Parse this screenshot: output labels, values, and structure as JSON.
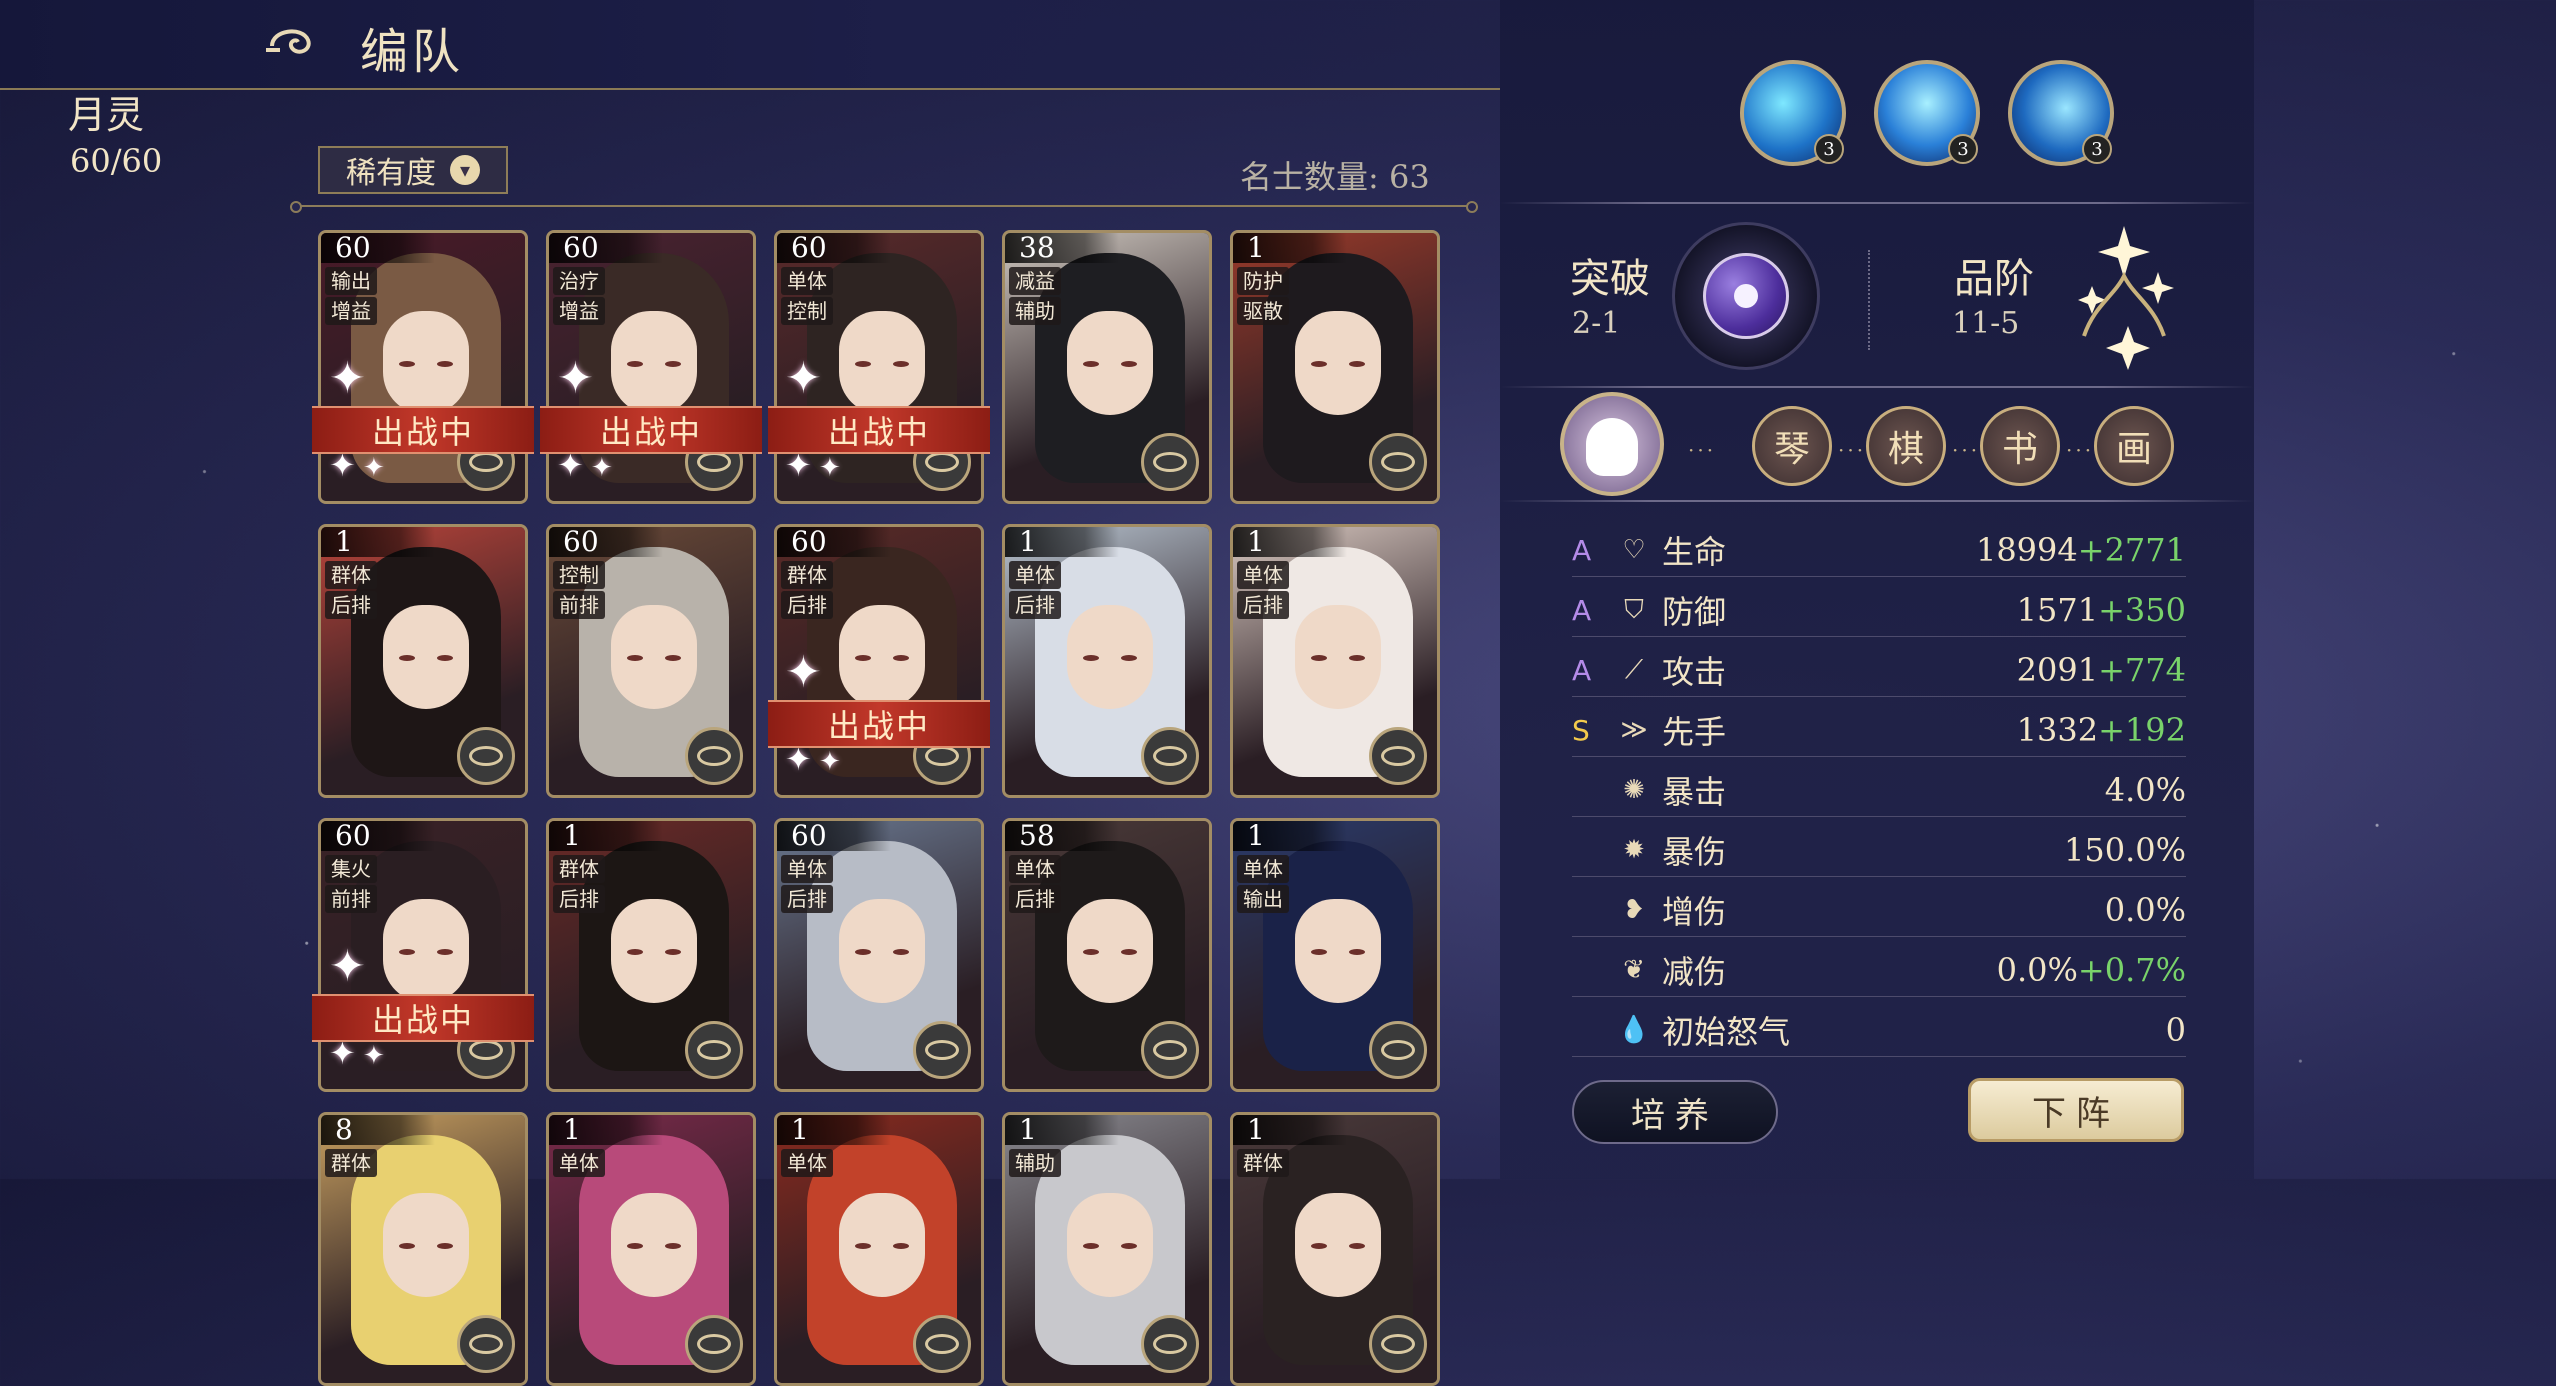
{
  "header": {
    "title": "编队"
  },
  "filter": {
    "label": "稀有度",
    "count_label": "名士数量: 63"
  },
  "status_banner": "出战中",
  "cards": [
    {
      "level": "60",
      "tags": [
        "输出",
        "增益"
      ],
      "deployed": true
    },
    {
      "level": "60",
      "tags": [
        "治疗",
        "增益"
      ],
      "deployed": true
    },
    {
      "level": "60",
      "tags": [
        "单体",
        "控制"
      ],
      "deployed": true
    },
    {
      "level": "38",
      "tags": [
        "减益",
        "辅助"
      ],
      "deployed": false
    },
    {
      "level": "1",
      "tags": [
        "防护",
        "驱散"
      ],
      "deployed": false
    },
    {
      "level": "1",
      "tags": [
        "群体",
        "后排"
      ],
      "deployed": false
    },
    {
      "level": "60",
      "tags": [
        "控制",
        "前排"
      ],
      "deployed": false
    },
    {
      "level": "60",
      "tags": [
        "群体",
        "后排"
      ],
      "deployed": true
    },
    {
      "level": "1",
      "tags": [
        "单体",
        "后排"
      ],
      "deployed": false
    },
    {
      "level": "1",
      "tags": [
        "单体",
        "后排"
      ],
      "deployed": false
    },
    {
      "level": "60",
      "tags": [
        "集火",
        "前排"
      ],
      "deployed": true
    },
    {
      "level": "1",
      "tags": [
        "群体",
        "后排"
      ],
      "deployed": false
    },
    {
      "level": "60",
      "tags": [
        "单体",
        "后排"
      ],
      "deployed": false
    },
    {
      "level": "58",
      "tags": [
        "单体",
        "后排"
      ],
      "deployed": false
    },
    {
      "level": "1",
      "tags": [
        "单体",
        "输出"
      ],
      "deployed": false
    },
    {
      "level": "8",
      "tags": [
        "群体"
      ],
      "deployed": false
    },
    {
      "level": "1",
      "tags": [
        "单体"
      ],
      "deployed": false
    },
    {
      "level": "1",
      "tags": [
        "单体"
      ],
      "deployed": false
    },
    {
      "level": "1",
      "tags": [
        "辅助"
      ],
      "deployed": false
    },
    {
      "level": "1",
      "tags": [
        "群体"
      ],
      "deployed": false
    }
  ],
  "hero": {
    "name": "月灵",
    "energy": "60/60",
    "skills": [
      {
        "level": "3"
      },
      {
        "level": "3"
      },
      {
        "level": "3"
      }
    ],
    "breakthrough_label": "突破",
    "breakthrough_value": "2-1",
    "grade_label": "品阶",
    "grade_value": "11-5",
    "talents": [
      "琴",
      "棋",
      "书",
      "画"
    ]
  },
  "stats": [
    {
      "grade": "A",
      "icon": "heart-icon",
      "name": "生命",
      "value": "18994",
      "bonus": "+2771"
    },
    {
      "grade": "A",
      "icon": "shield-icon",
      "name": "防御",
      "value": "1571",
      "bonus": "+350"
    },
    {
      "grade": "A",
      "icon": "sword-icon",
      "name": "攻击",
      "value": "2091",
      "bonus": "+774"
    },
    {
      "grade": "S",
      "icon": "speed-icon",
      "name": "先手",
      "value": "1332",
      "bonus": "+192"
    },
    {
      "grade": "",
      "icon": "crit-icon",
      "name": "暴击",
      "value": "4.0%",
      "bonus": ""
    },
    {
      "grade": "",
      "icon": "crit-damage-icon",
      "name": "暴伤",
      "value": "150.0%",
      "bonus": ""
    },
    {
      "grade": "",
      "icon": "damage-up-icon",
      "name": "增伤",
      "value": "0.0%",
      "bonus": ""
    },
    {
      "grade": "",
      "icon": "damage-reduce-icon",
      "name": "减伤",
      "value": "0.0%",
      "bonus": "+0.7%"
    },
    {
      "grade": "",
      "icon": "rage-icon",
      "name": "初始怒气",
      "value": "0",
      "bonus": ""
    }
  ],
  "buttons": {
    "train": "培养",
    "remove": "下阵"
  },
  "colors": {
    "grade_A": "#b48be8",
    "grade_S": "#f2c94c",
    "bonus": "#79d36a",
    "banner": "#c2382a"
  }
}
